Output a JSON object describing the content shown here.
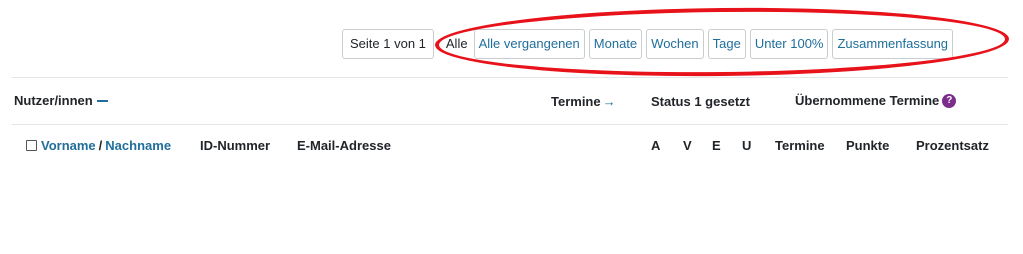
{
  "pager": {
    "label": "Seite 1 von 1"
  },
  "filters": {
    "static_label": "Alle",
    "buttons": [
      "Alle vergangenen",
      "Monate",
      "Wochen",
      "Tage",
      "Unter 100%",
      "Zusammenfassung"
    ]
  },
  "table": {
    "header_row1": {
      "users": "Nutzer/innen",
      "termine": "Termine",
      "status": "Status 1 gesetzt",
      "uebernommen": "Übernommene Termine",
      "help_glyph": "?"
    },
    "header_row2": {
      "vorname": "Vorname",
      "separator": "/",
      "nachname": "Nachname",
      "id": "ID-Nummer",
      "email": "E-Mail-Adresse",
      "a": "A",
      "v": "V",
      "e": "E",
      "u": "U",
      "termine": "Termine",
      "punkte": "Punkte",
      "prozentsatz": "Prozentsatz"
    }
  },
  "colors": {
    "link": "#1f6e9c",
    "highlight": "#e8121a",
    "help_icon": "#7b2d8b"
  },
  "icons": [
    "minus-icon",
    "arrow-right-icon",
    "help-icon",
    "checkbox"
  ]
}
